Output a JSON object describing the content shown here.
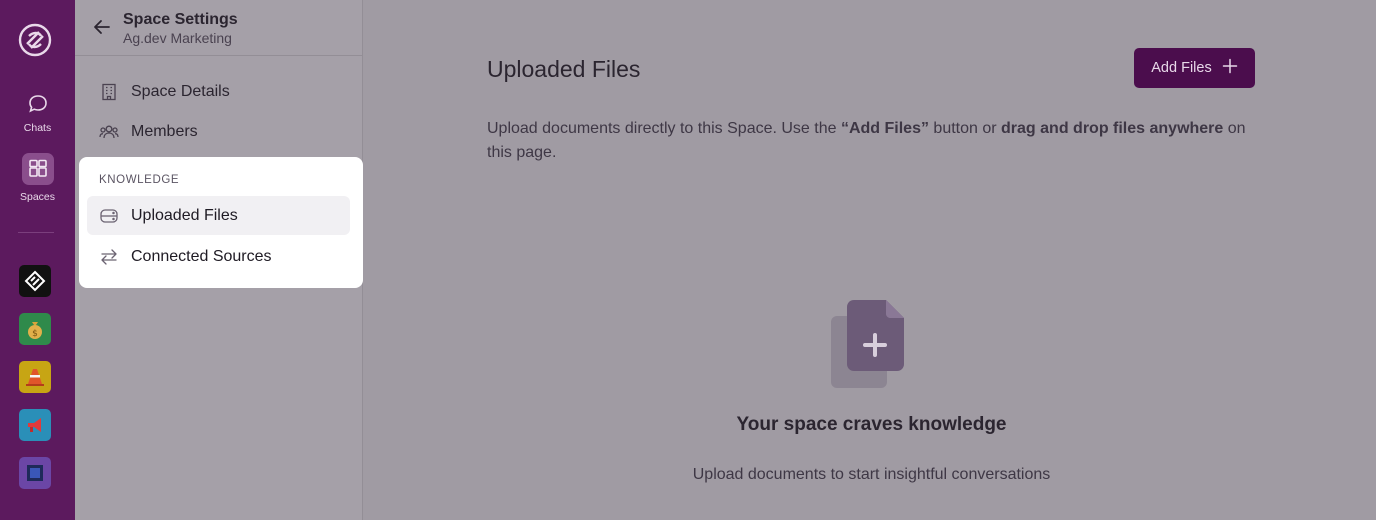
{
  "rail": {
    "chats_label": "Chats",
    "spaces_label": "Spaces",
    "apps": [
      {
        "icon": "layers-logo-icon",
        "bg": "#111111"
      },
      {
        "icon": "money-bag-icon",
        "bg": "#2f8a4b"
      },
      {
        "icon": "traffic-cone-icon",
        "bg": "#c7a514"
      },
      {
        "icon": "megaphone-icon",
        "bg": "#2a8fb8"
      },
      {
        "icon": "chip-icon",
        "bg": "#6b46a6"
      }
    ]
  },
  "panel": {
    "title": "Space Settings",
    "subtitle": "Ag.dev Marketing",
    "nav": {
      "details": "Space Details",
      "members": "Members"
    },
    "knowledge": {
      "section_label": "KNOWLEDGE",
      "uploaded": "Uploaded Files",
      "connected": "Connected Sources"
    }
  },
  "main": {
    "title": "Uploaded Files",
    "add_button": "Add Files",
    "desc_part1": "Upload documents directly to this Space. Use the ",
    "desc_bold1": "“Add Files”",
    "desc_part2": " button or ",
    "desc_bold2": "drag and drop files anywhere",
    "desc_part3": " on this page.",
    "empty_title": "Your space craves knowledge",
    "empty_sub": "Upload documents to start insightful conversations"
  },
  "colors": {
    "rail": "#5c1a5e",
    "accent_button": "#4b0d4d",
    "overlay": "#a09ba3"
  }
}
